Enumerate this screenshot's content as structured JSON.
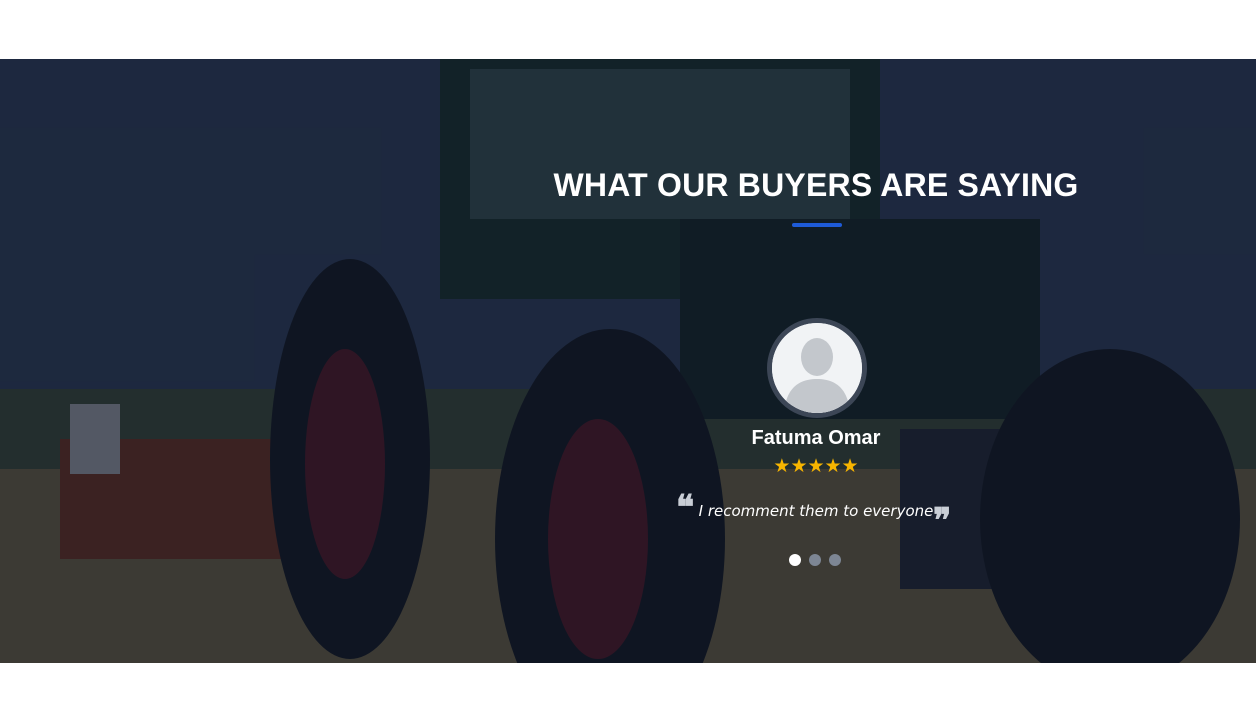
{
  "section": {
    "heading": "WHAT OUR BUYERS ARE SAYING",
    "accent_color": "#1e5bd8",
    "background_image": "tractor-in-field"
  },
  "testimonial": {
    "name": "Fatuma Omar",
    "avatar_icon": "user-placeholder-icon",
    "rating": 5,
    "stars": "★★★★★",
    "star_color": "#f7b500",
    "text": "I recomment them to everyone",
    "quote_open": "❝",
    "quote_close": "❞"
  },
  "carousel": {
    "slides": 3,
    "active_index": 0
  }
}
